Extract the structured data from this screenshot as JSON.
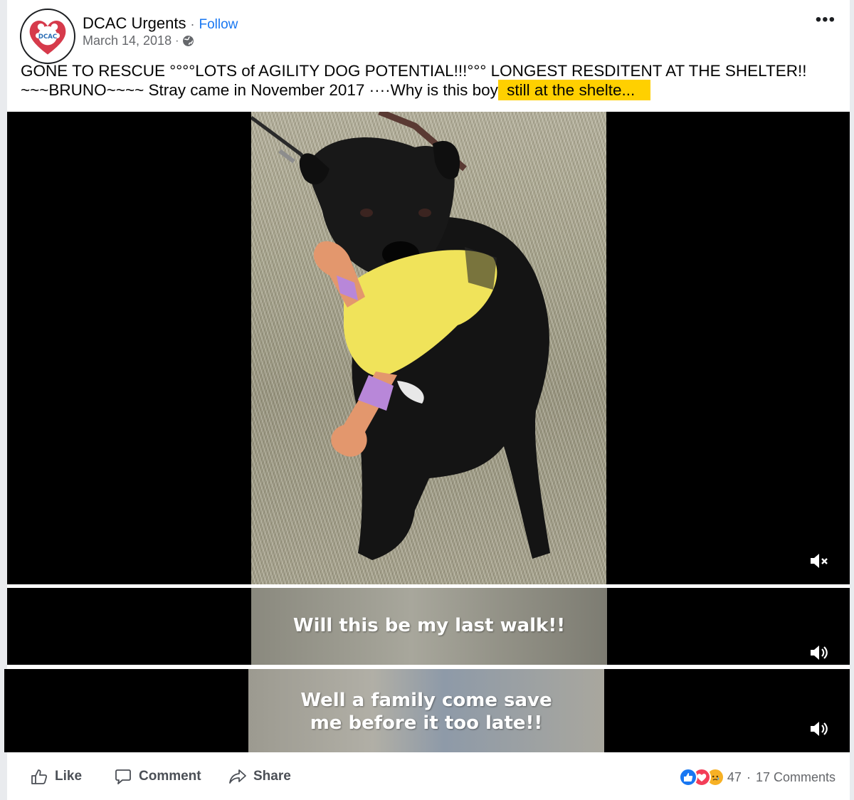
{
  "post": {
    "author": "DCAC Urgents",
    "separator": "·",
    "follow_label": "Follow",
    "date": "March 14, 2018",
    "meta_separator": "·",
    "privacy_icon": "globe-icon",
    "more_icon": "more-options-icon",
    "more_glyph": "•••",
    "avatar_text": "DCAC",
    "text_main": "GONE TO RESCUE °°°°LOTS of AGILITY DOG POTENTIAL!!!°°° LONGEST RESDITENT AT THE SHELTER!! ~~~BRUNO~~~~ Stray came in November 2017 ····Why is this boy",
    "text_highlight": " still at the shelte..."
  },
  "videos": [
    {
      "id": "video-1",
      "caption": "",
      "audio_icon": "volume-muted-icon"
    },
    {
      "id": "video-2",
      "caption": "Will this be my last walk!!",
      "audio_icon": "volume-on-icon"
    },
    {
      "id": "video-3",
      "caption": "Well a family come save me before it too late!!",
      "audio_icon": "volume-on-icon"
    }
  ],
  "actions": {
    "like_label": "Like",
    "comment_label": "Comment",
    "share_label": "Share"
  },
  "reactions": {
    "icons": [
      "like-reaction-icon",
      "love-reaction-icon",
      "sad-reaction-icon"
    ],
    "count": "47",
    "separator": "·",
    "comments": "17 Comments"
  },
  "colors": {
    "link_blue": "#1877f2",
    "highlight": "#ffd000",
    "secondary_text": "#65676b",
    "like_blue": "#1877f2",
    "love_red": "#f33e58",
    "sad_yellow": "#f7b125"
  }
}
